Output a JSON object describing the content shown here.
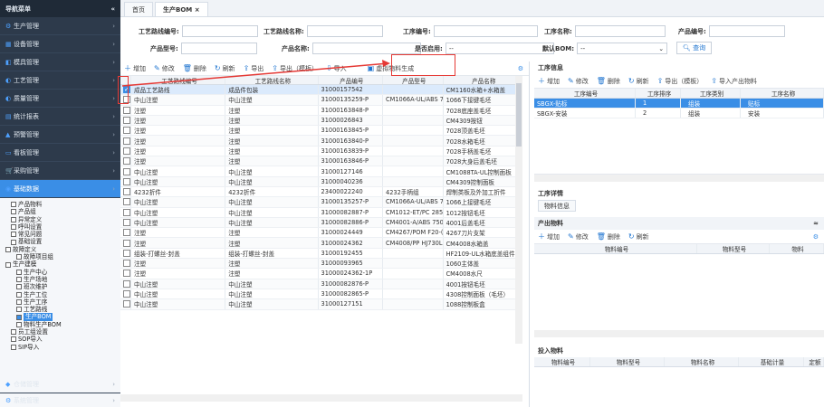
{
  "sidebar": {
    "title": "导航菜单",
    "collapse": "«",
    "menu": [
      {
        "label": "生产管理",
        "icon": "⚙"
      },
      {
        "label": "设备管理",
        "icon": "▦"
      },
      {
        "label": "模具管理",
        "icon": "◧"
      },
      {
        "label": "工艺管理",
        "icon": "◐"
      },
      {
        "label": "质量管理",
        "icon": "◐"
      },
      {
        "label": "统计报表",
        "icon": "▤"
      },
      {
        "label": "预警管理",
        "icon": "▲"
      },
      {
        "label": "看板管理",
        "icon": "▭"
      },
      {
        "label": "采购管理",
        "icon": "🛒"
      },
      {
        "label": "基础数据",
        "icon": "◉"
      }
    ],
    "tree": [
      {
        "label": "产品物料",
        "indent": 1
      },
      {
        "label": "产品组",
        "indent": 1
      },
      {
        "label": "异常定义",
        "indent": 1
      },
      {
        "label": "呼叫设置",
        "indent": 1
      },
      {
        "label": "常见问题",
        "indent": 1
      },
      {
        "label": "基础设置",
        "indent": 1
      },
      {
        "label": "故障定义",
        "indent": 0
      },
      {
        "label": "故障项目组",
        "indent": 2
      },
      {
        "label": "生产建模",
        "indent": 0
      },
      {
        "label": "生产中心",
        "indent": 2
      },
      {
        "label": "生产场地",
        "indent": 2
      },
      {
        "label": "班次维护",
        "indent": 2
      },
      {
        "label": "生产工位",
        "indent": 2
      },
      {
        "label": "生产工序",
        "indent": 2
      },
      {
        "label": "工艺路线",
        "indent": 2
      },
      {
        "label": "生产BOM",
        "indent": 2,
        "selected": true
      },
      {
        "label": "物料生产BOM",
        "indent": 2
      },
      {
        "label": "员工组设置",
        "indent": 1
      },
      {
        "label": "SOP导入",
        "indent": 1
      },
      {
        "label": "SIP导入",
        "indent": 1
      }
    ],
    "bottom": [
      {
        "label": "仓储管理",
        "icon": "◆"
      },
      {
        "label": "系统管理",
        "icon": "⚙"
      }
    ]
  },
  "tabs": [
    "首页",
    "生产BOM ×"
  ],
  "form": {
    "route_code": "工艺路线编号:",
    "route_name": "工艺路线名称:",
    "step_code": "工序编号:",
    "step_name": "工序名称:",
    "product_code": "产品编号:",
    "product_model": "产品型号:",
    "product_name": "产品名称:",
    "enabled": "是否启用:",
    "enabled_value": "--",
    "default_bom": "默认BOM:",
    "default_bom_value": "--",
    "query": "查询"
  },
  "toolbar": [
    "增加",
    "修改",
    "删除",
    "刷新",
    "导出",
    "导出（模板）",
    "导入",
    "虚拟物料生成"
  ],
  "grid": {
    "headers": [
      "工艺路线编号",
      "工艺路线名称",
      "产品编号",
      "产品型号",
      "产品名称"
    ],
    "rows": [
      [
        "成品工艺路线",
        "成品件包装",
        "31000157542",
        "",
        "CM1160水箱+水箱盖"
      ],
      [
        "中山注塑",
        "中山注塑",
        "31000135259-P",
        "CM1066A-UL/ABS 7",
        "1066下接键毛坯"
      ],
      [
        "注塑",
        "注塑",
        "31000163848-P",
        "",
        "7028底座盖毛坯"
      ],
      [
        "注塑",
        "注塑",
        "31000026843",
        "",
        "CM4309按钮"
      ],
      [
        "注塑",
        "注塑",
        "31000163845-P",
        "",
        "7028顶盖毛坯"
      ],
      [
        "注塑",
        "注塑",
        "31000163840-P",
        "",
        "7028水箱毛坯"
      ],
      [
        "注塑",
        "注塑",
        "31000163839-P",
        "",
        "7028手柄盖毛坯"
      ],
      [
        "注塑",
        "注塑",
        "31000163846-P",
        "",
        "7028大身后盖毛坯"
      ],
      [
        "中山注塑",
        "中山注塑",
        "31000127146",
        "",
        "CM1088TA-UL控制面板"
      ],
      [
        "中山注塑",
        "中山注塑",
        "31000040236",
        "",
        "CM4309控制面板"
      ],
      [
        "4232折件",
        "4232折件",
        "23400022240",
        "4232手柄组",
        "焊制类板及外加工折件"
      ],
      [
        "中山注塑",
        "中山注塑",
        "31000135257-P",
        "CM1066A-UL/ABS 7",
        "1066上接键毛坯"
      ],
      [
        "中山注塑",
        "中山注塑",
        "31000082887-P",
        "CM1012-ET/PC 285(",
        "1012按钮毛坯"
      ],
      [
        "中山注塑",
        "中山注塑",
        "31000082886-P",
        "CM4001-A/ABS 750",
        "4001后盖毛坯"
      ],
      [
        "注塑",
        "注塑",
        "31000024449",
        "CM4267/POM F20-(",
        "4267刀片支架"
      ],
      [
        "注塑",
        "注塑",
        "31000024362",
        "CM4008/PP HJ730L",
        "CM4008水箱盖"
      ],
      [
        "组装-打螺丝-封盖",
        "组装-打螺丝-封盖",
        "31000192455",
        "",
        "HF2109-UL水箱底盖组件"
      ],
      [
        "注塑",
        "注塑",
        "31000093965",
        "",
        "1060主体盖"
      ],
      [
        "注塑",
        "注塑",
        "31000024362-1P",
        "",
        "CM4008水尺"
      ],
      [
        "中山注塑",
        "中山注塑",
        "31000082876-P",
        "",
        "4001按钮毛坯"
      ],
      [
        "中山注塑",
        "中山注塑",
        "31000082865-P",
        "",
        "4308控制面板（毛坯）"
      ],
      [
        "中山注塑",
        "中山注塑",
        "31000127151",
        "",
        "1088控制板盒"
      ]
    ]
  },
  "right": {
    "process_title": "工序信息",
    "process_toolbar": [
      "增加",
      "修改",
      "删除",
      "刷新",
      "导出（模板）",
      "导入产出物料"
    ],
    "process_headers": [
      "工序编号",
      "工序排序",
      "工序类别",
      "工序名称"
    ],
    "process_rows": [
      [
        "SBGX-贴标",
        "1",
        "组装",
        "贴标"
      ],
      [
        "SBGX-安装",
        "2",
        "组装",
        "安装"
      ]
    ],
    "detail_title": "工序详情",
    "detail_tab": "物料信息",
    "output_title": "产出物料",
    "output_toolbar": [
      "增加",
      "修改",
      "删除",
      "刷新"
    ],
    "output_headers": [
      "物料编号",
      "物料型号",
      "物料"
    ],
    "input_title": "投入物料",
    "input_headers": [
      "物料编号",
      "物料型号",
      "物料名称",
      "基础计量",
      "定额"
    ]
  },
  "colors": {
    "sidebar": "#2d3a4b",
    "accent": "#3a8ee6",
    "annotation": "#e53935"
  }
}
